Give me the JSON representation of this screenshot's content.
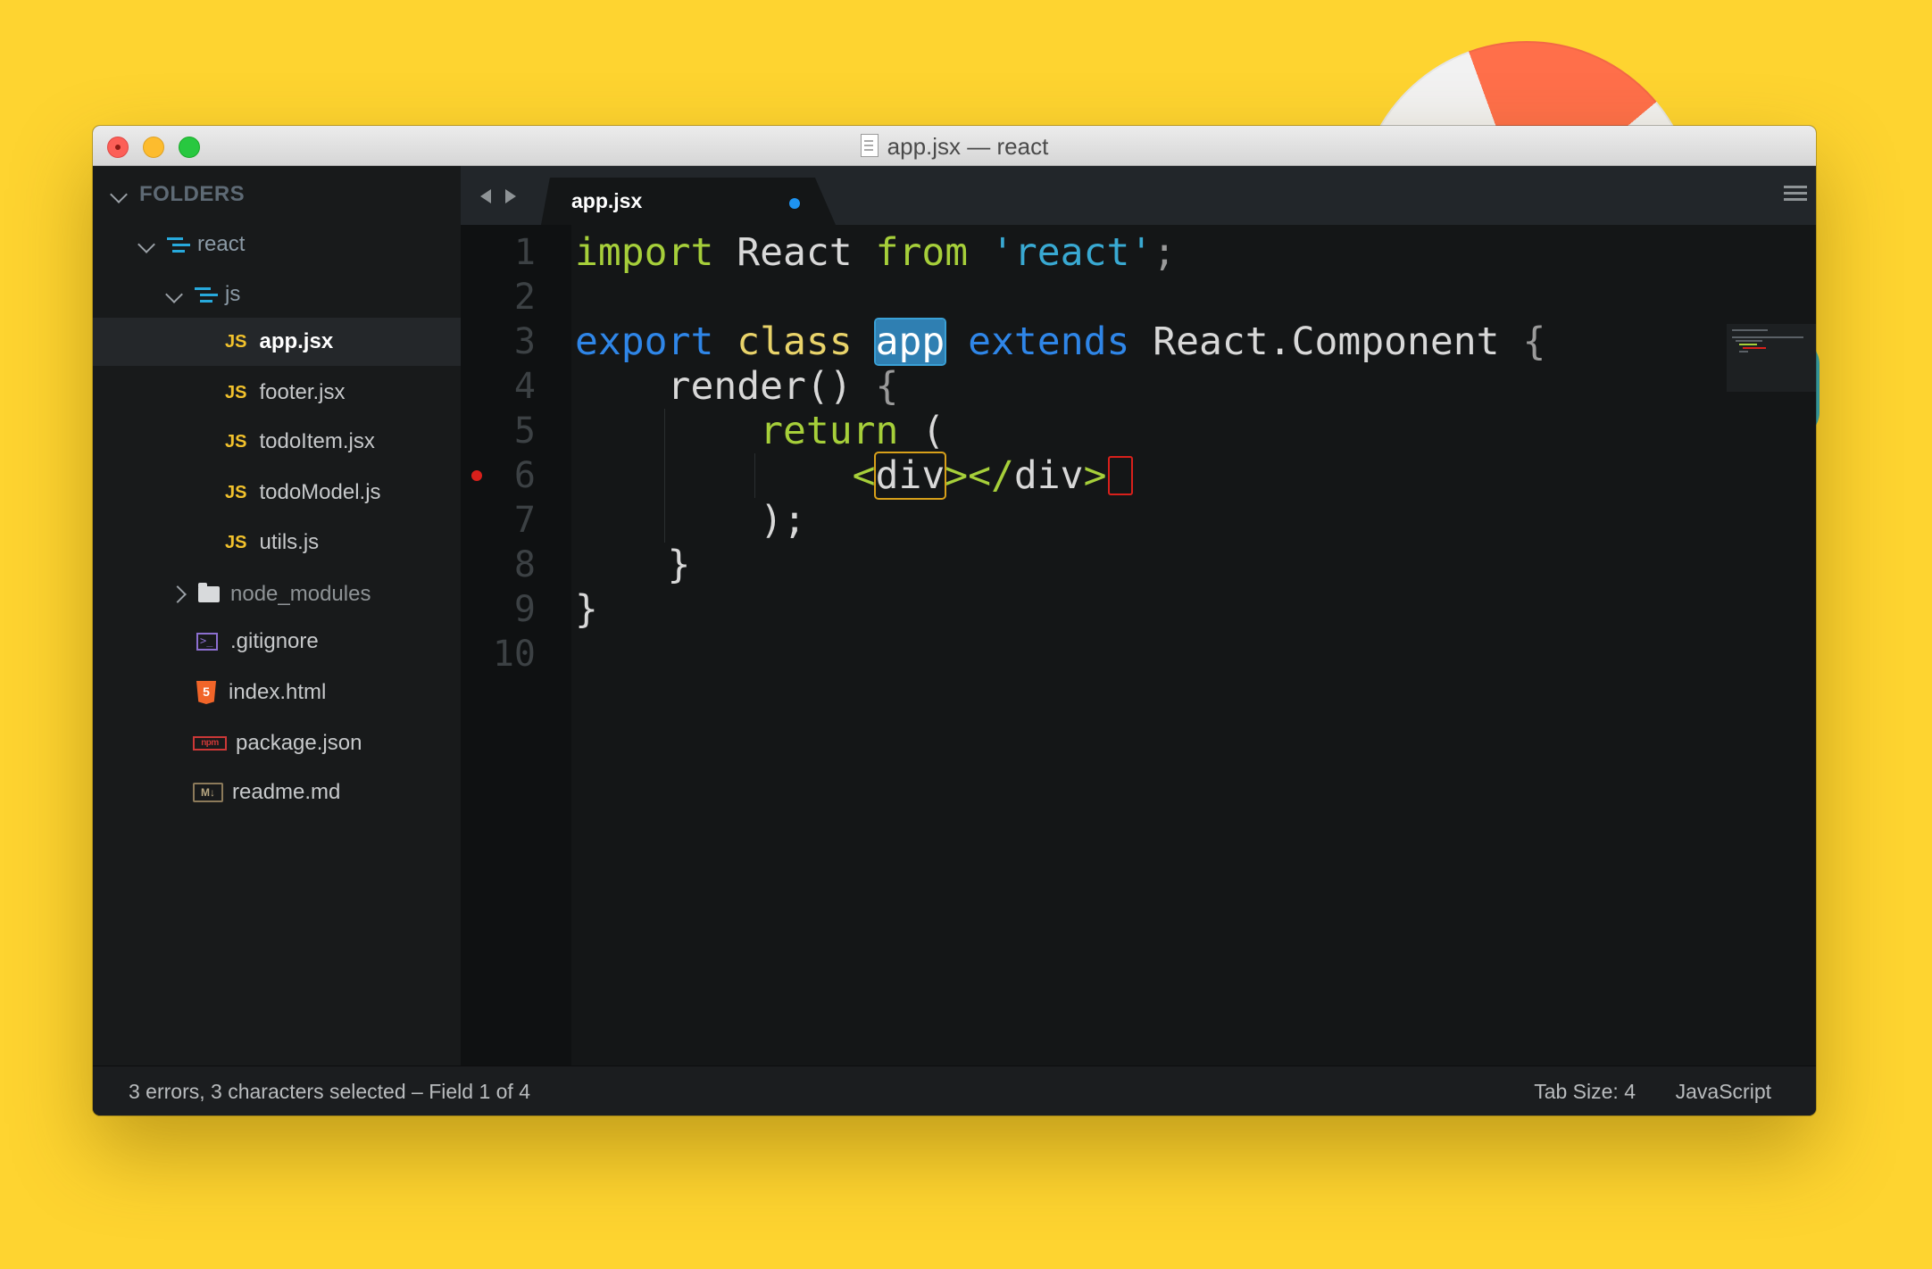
{
  "window": {
    "title": "app.jsx — react"
  },
  "sidebar": {
    "header": "FOLDERS",
    "items": [
      {
        "label": "react",
        "type": "folder-open"
      },
      {
        "label": "js",
        "type": "folder-open"
      },
      {
        "label": "app.jsx",
        "type": "js",
        "icon_text": "JS",
        "active": true
      },
      {
        "label": "footer.jsx",
        "type": "js",
        "icon_text": "JS"
      },
      {
        "label": "todoItem.jsx",
        "type": "js",
        "icon_text": "JS"
      },
      {
        "label": "todoModel.js",
        "type": "js",
        "icon_text": "JS"
      },
      {
        "label": "utils.js",
        "type": "js",
        "icon_text": "JS"
      },
      {
        "label": "node_modules",
        "type": "folder-closed"
      },
      {
        "label": ".gitignore",
        "type": "terminal"
      },
      {
        "label": "index.html",
        "type": "html"
      },
      {
        "label": "package.json",
        "type": "npm",
        "icon_text": "npm"
      },
      {
        "label": "readme.md",
        "type": "markdown",
        "icon_text": "M↓"
      }
    ]
  },
  "editor": {
    "tab": {
      "label": "app.jsx",
      "modified": true
    },
    "line_numbers": [
      "1",
      "2",
      "3",
      "4",
      "5",
      "6",
      "7",
      "8",
      "9",
      "10"
    ],
    "error_line": 6,
    "lines": {
      "l1": {
        "t1": "import",
        "t2": " React ",
        "t3": "from",
        "t4": " ",
        "t5": "'react'",
        "t6": ";"
      },
      "l3": {
        "t1": "export",
        "t2": " ",
        "t3": "class",
        "t4": " ",
        "t5": "app",
        "t6": " ",
        "t7": "extends",
        "t8": " React.Component ",
        "t9": "{"
      },
      "l4": {
        "t1": "    render() ",
        "t2": "{"
      },
      "l5": {
        "t1": "        ",
        "t2": "return",
        "t3": " ("
      },
      "l6": {
        "t1": "            ",
        "t2": "<",
        "t3": "div",
        "t4": ">",
        "t5": "</",
        "t6": "div",
        "t7": ">"
      },
      "l7": {
        "t1": "        );"
      },
      "l8": {
        "t1": "    }"
      },
      "l9": {
        "t1": "}"
      }
    }
  },
  "statusbar": {
    "left": "3 errors, 3 characters selected – Field 1 of 4",
    "tab_size": "Tab Size: 4",
    "syntax": "JavaScript"
  },
  "colors": {
    "background": "#fed430",
    "keyword_green": "#a6cf3a",
    "keyword_blue": "#2f86e8",
    "keyword_yellow": "#e9d36a",
    "string": "#39a9d2",
    "error": "#d8201b",
    "modified_dot": "#1e94f2"
  },
  "icons": [
    "close-icon",
    "minimize-icon",
    "maximize-icon",
    "document-icon",
    "chevron-down-icon",
    "chevron-right-icon",
    "folder-tree-icon",
    "folder-icon",
    "js-file-icon",
    "terminal-icon",
    "html5-icon",
    "npm-icon",
    "markdown-icon",
    "arrow-left-icon",
    "arrow-right-icon",
    "menu-icon",
    "error-dot-icon"
  ]
}
